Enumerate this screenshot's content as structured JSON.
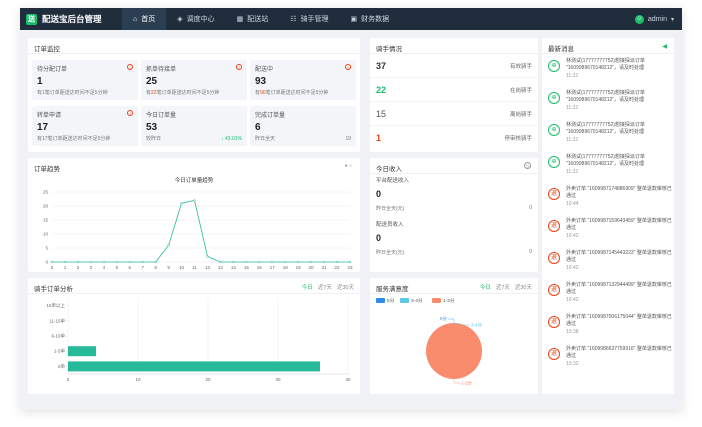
{
  "app": {
    "logo_char": "送",
    "title": "配送宝后台管理"
  },
  "nav": [
    {
      "label": "首页",
      "icon": "home-icon",
      "glyph": "⌂",
      "active": true
    },
    {
      "label": "调度中心",
      "icon": "dispatch-icon",
      "glyph": "◈",
      "active": false
    },
    {
      "label": "配送站",
      "icon": "station-icon",
      "glyph": "▦",
      "active": false
    },
    {
      "label": "骑手管理",
      "icon": "rider-icon",
      "glyph": "☷",
      "active": false
    },
    {
      "label": "财务数据",
      "icon": "finance-icon",
      "glyph": "▣",
      "active": false
    }
  ],
  "user": {
    "name": "admin",
    "avatar_glyph": "☺",
    "caret": "▾"
  },
  "order_monitor": {
    "title": "订单监控",
    "cards": [
      {
        "label": "待分配订单",
        "value": "1",
        "desc_pre": "有1笔订单距送达时间不足5分钟",
        "hl": "",
        "desc_post": "",
        "info": true
      },
      {
        "label": "抓单待接单",
        "value": "25",
        "desc_pre": "有",
        "hl": "22",
        "desc_post": "笔订单距送达时间不足5分钟",
        "info": true
      },
      {
        "label": "配送中",
        "value": "93",
        "desc_pre": "有",
        "hl": "90",
        "desc_post": "笔订单距送达时间不足5分钟",
        "info": true
      },
      {
        "label": "转单申请",
        "value": "17",
        "desc_pre": "有17笔订单距送达时间不足5分钟",
        "hl": "",
        "desc_post": "",
        "info": true
      },
      {
        "label": "今日订单量",
        "value": "53",
        "desc_pre": "较昨日",
        "hl": "",
        "desc_post": "",
        "pct": "↓ 43.01%"
      },
      {
        "label": "完成订单量",
        "value": "6",
        "desc_pre": "昨日全天",
        "hl": "",
        "desc_post": "",
        "num": "19"
      }
    ]
  },
  "riders": {
    "title": "骑手情况",
    "rows": [
      {
        "value": "37",
        "label": "有效骑手",
        "color": "#222222"
      },
      {
        "value": "22",
        "label": "在岗骑手",
        "color": "#19be6b"
      },
      {
        "value": "15",
        "label": "离岗骑手",
        "color": "#555555"
      },
      {
        "value": "1",
        "label": "停审核骑手",
        "color": "#ed4014"
      }
    ]
  },
  "messages": {
    "title": "最新消息",
    "items": [
      {
        "type": "green",
        "glyph": "⊕",
        "text": "林测试(17777777752)想接探派订单 \"1609989670148212\"，请及时处理",
        "time": "11:22"
      },
      {
        "type": "green",
        "glyph": "⊕",
        "text": "林测试(17777777752)想接探派订单 \"1609989670148212\"，请及时处理",
        "time": "11:22"
      },
      {
        "type": "green",
        "glyph": "⊕",
        "text": "林测试(17777777752)想接探派订单 \"1609989670148212\"，请及时处理",
        "time": "11:22"
      },
      {
        "type": "green",
        "glyph": "⊕",
        "text": "林测试(17777777752)想接探派订单 \"1609989670148212\"，请及时处理",
        "time": "11:22"
      },
      {
        "type": "red",
        "glyph": "退",
        "text": "外卖订单 \"1609987174886909\" 整单退款审核已通过",
        "time": "10:44"
      },
      {
        "type": "red",
        "glyph": "退",
        "text": "外卖订单 \"1609987159643459\" 整单退款审核已通过",
        "time": "10:42"
      },
      {
        "type": "red",
        "glyph": "退",
        "text": "外卖订单 \"1609987145443223\" 整单退款审核已通过",
        "time": "10:42"
      },
      {
        "type": "red",
        "glyph": "退",
        "text": "外卖订单 \"1609987132944499\" 整单退款审核已通过",
        "time": "10:42"
      },
      {
        "type": "red",
        "glyph": "退",
        "text": "外卖订单 \"1609987006175044\" 整单退款审核已通过",
        "time": "10:38"
      },
      {
        "type": "red",
        "glyph": "退",
        "text": "外卖订单 \"1609986637759916\" 整单退款审核已通过",
        "time": "10:32"
      }
    ]
  },
  "trend": {
    "title": "订单趋势",
    "subtitle": "今日订单量趋势"
  },
  "today_income": {
    "title": "今日收入",
    "platform_label": "平台配送收入",
    "platform_value": "0",
    "platform_yest_label": "昨日全天(元)",
    "platform_yest_value": "0",
    "rider_label": "配送员收入",
    "rider_value": "0",
    "rider_yest_label": "昨日全天(元)",
    "rider_yest_value": "0"
  },
  "rider_analysis": {
    "title": "骑手订单分析",
    "tabs": [
      "今日",
      "近7天",
      "近30天"
    ]
  },
  "satisfaction": {
    "title": "服务满意度",
    "tabs": [
      "今日",
      "近7天",
      "近30天"
    ]
  },
  "colors": {
    "accent": "#19be6b",
    "teal": "#26b99a",
    "danger": "#ed4014",
    "topbar": "#1f2d3d"
  },
  "chart_data": [
    {
      "type": "line",
      "title": "今日订单量趋势",
      "x": [
        0,
        1,
        2,
        3,
        4,
        5,
        6,
        7,
        8,
        9,
        10,
        11,
        12,
        13,
        14,
        15,
        16,
        17,
        18,
        19,
        20,
        21,
        22,
        23
      ],
      "values": [
        0,
        0,
        0,
        0,
        0,
        0,
        0,
        0,
        0,
        6,
        21,
        22,
        2,
        0,
        0,
        0,
        0,
        0,
        0,
        0,
        0,
        0,
        0,
        0
      ],
      "yticks": [
        0,
        5,
        10,
        15,
        20,
        25
      ],
      "ylim": [
        0,
        25
      ],
      "grid": true
    },
    {
      "type": "bar",
      "orientation": "horizontal",
      "categories": [
        "15单以上",
        "11-15单",
        "6-10单",
        "1-5单",
        "0单"
      ],
      "values": [
        0,
        0,
        0,
        4,
        36
      ],
      "xticks": [
        0,
        10,
        20,
        30,
        40
      ],
      "xlim": [
        0,
        40
      ],
      "color": "#26b99a"
    },
    {
      "type": "pie",
      "legend": [
        "5分",
        "3-4分",
        "1-2分"
      ],
      "legend_colors": [
        "#2d8cf0",
        "#5cc8e8",
        "#fa8c6e"
      ],
      "values": [
        0,
        0,
        100
      ],
      "slice_labels": [
        "5分",
        "3-4分",
        "1-2分"
      ],
      "legend_position": "top-left"
    }
  ]
}
